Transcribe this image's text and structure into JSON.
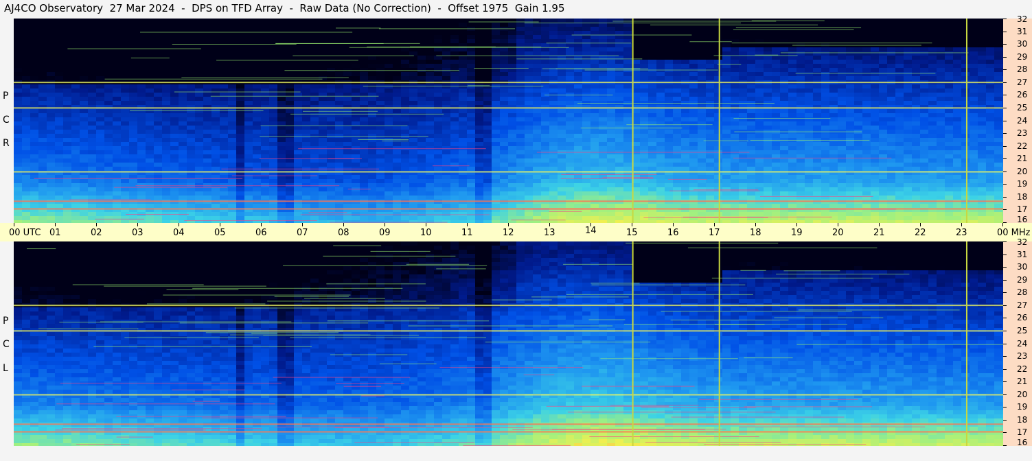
{
  "title": "AJ4CO Observatory  27 Mar 2024  -  DPS on TFD Array  -  Raw Data (No Correction)  -  Offset 1975  Gain 1.95",
  "time_axis": {
    "labels": [
      "00 UTC",
      "01",
      "02",
      "03",
      "04",
      "05",
      "06",
      "07",
      "08",
      "09",
      "10",
      "11",
      "12",
      "13",
      "14",
      "15",
      "16",
      "17",
      "18",
      "19",
      "20",
      "21",
      "22",
      "23",
      "00 MHz"
    ]
  },
  "freq_axis": {
    "labels": [
      "32",
      "31",
      "30",
      "29",
      "28",
      "27",
      "26",
      "25",
      "24",
      "23",
      "22",
      "21",
      "20",
      "19",
      "18",
      "17",
      "16"
    ]
  },
  "panels": [
    {
      "key": "rcp",
      "letters": [
        "P",
        "C",
        "R"
      ]
    },
    {
      "key": "lcp",
      "letters": [
        "P",
        "C",
        "L"
      ]
    }
  ],
  "chart_data": {
    "type": "heatmap",
    "title": "AJ4CO Observatory  27 Mar 2024  -  DPS on TFD Array  -  Raw Data (No Correction)  -  Offset 1975  Gain 1.95",
    "xlabel": "UTC",
    "ylabel": "MHz",
    "x_range_hours": [
      0,
      24
    ],
    "y_range_mhz": [
      16,
      32
    ],
    "colormap": [
      "#000018",
      "#001a8c",
      "#0050e6",
      "#1e96f0",
      "#3cd2e6",
      "#a0f080",
      "#f0f050",
      "#ff9040",
      "#ff2060"
    ],
    "panels": [
      "RCP",
      "LCP"
    ],
    "rfi_lines_mhz": [
      25,
      27,
      20,
      17.7,
      17.1
    ],
    "vertical_lines_utc": [
      15.0,
      17.1,
      23.1
    ],
    "grid": false
  }
}
